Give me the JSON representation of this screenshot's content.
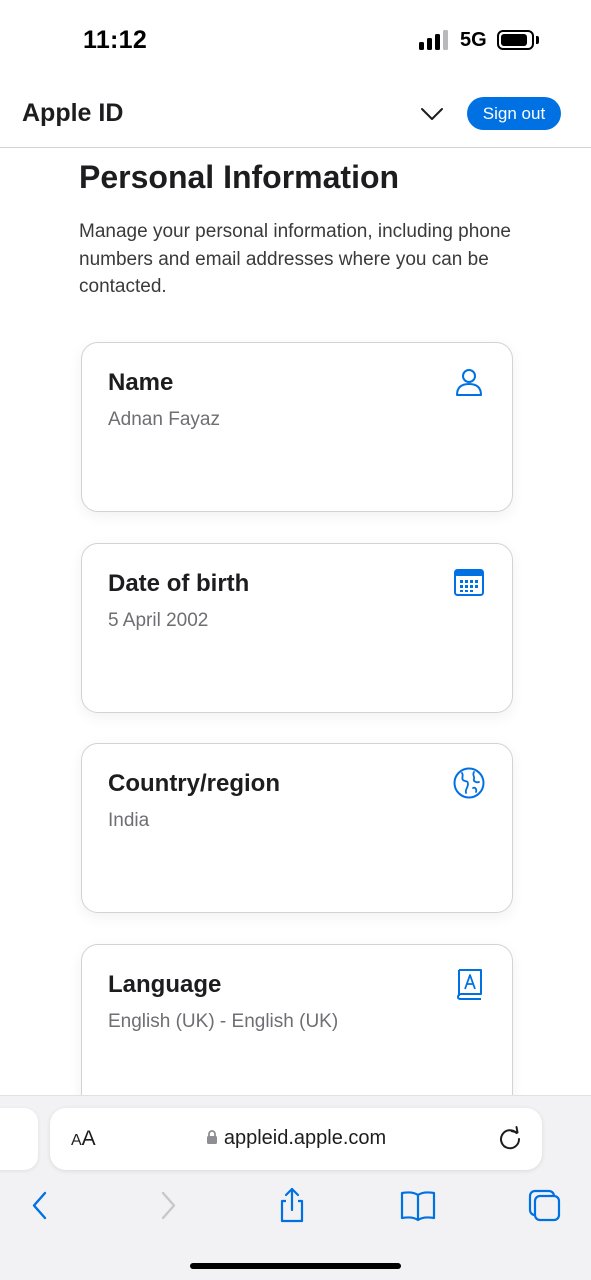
{
  "status_bar": {
    "time": "11:12",
    "network": "5G",
    "battery_level": 0.9
  },
  "header": {
    "title": "Apple ID",
    "sign_out_label": "Sign out",
    "menu_icon": "chevron-down-icon"
  },
  "page": {
    "heading": "Personal Information",
    "description": "Manage your personal information, including phone numbers and email addresses where you can be contacted."
  },
  "cards": [
    {
      "title": "Name",
      "value": "Adnan Fayaz",
      "icon": "person-icon"
    },
    {
      "title": "Date of birth",
      "value": "5 April 2002",
      "icon": "calendar-icon"
    },
    {
      "title": "Country/region",
      "value": "India",
      "icon": "globe-icon"
    },
    {
      "title": "Language",
      "value": "English (UK) - English (UK)",
      "icon": "language-book-icon"
    }
  ],
  "safari": {
    "text_size_small": "A",
    "text_size_large": "A",
    "url": "appleid.apple.com",
    "toolbar_icons": [
      "back-icon",
      "forward-icon",
      "share-icon",
      "bookmarks-icon",
      "tabs-icon"
    ]
  },
  "colors": {
    "accent": "#0071e3",
    "text": "#1d1d1f",
    "secondary_text": "#6e6e73",
    "toolbar_bg": "#f2f2f4"
  }
}
